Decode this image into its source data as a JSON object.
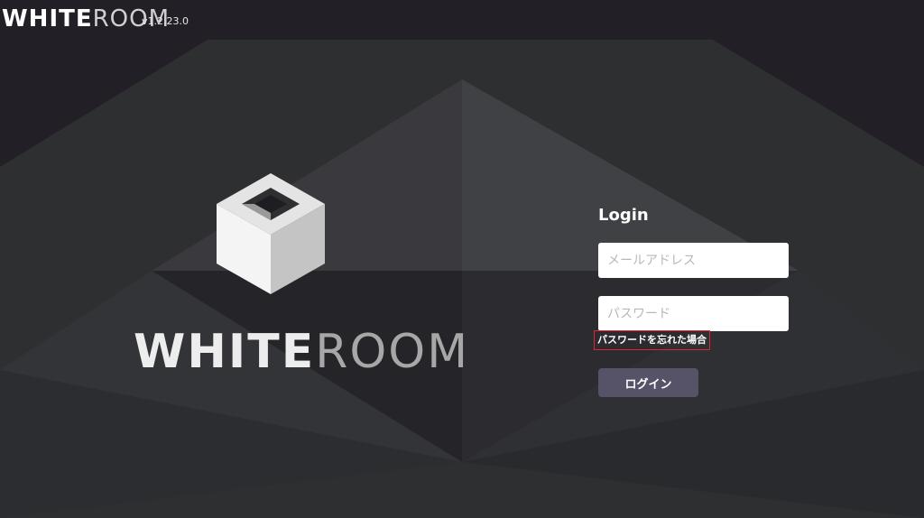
{
  "header": {
    "brand_white": "WHITE",
    "brand_room": "ROOM",
    "version": "v1.2.23.0"
  },
  "hero": {
    "logo_white": "WHITE",
    "logo_room": "ROOM"
  },
  "login": {
    "title": "Login",
    "email_placeholder": "メールアドレス",
    "email_value": "",
    "password_placeholder": "パスワード",
    "password_value": "",
    "forgot_label": "パスワードを忘れた場合",
    "submit_label": "ログイン"
  },
  "colors": {
    "background": "#222026",
    "button": "#565369",
    "highlight_border": "#e0262c"
  },
  "icons": {
    "cube": "cube-logo-icon"
  }
}
